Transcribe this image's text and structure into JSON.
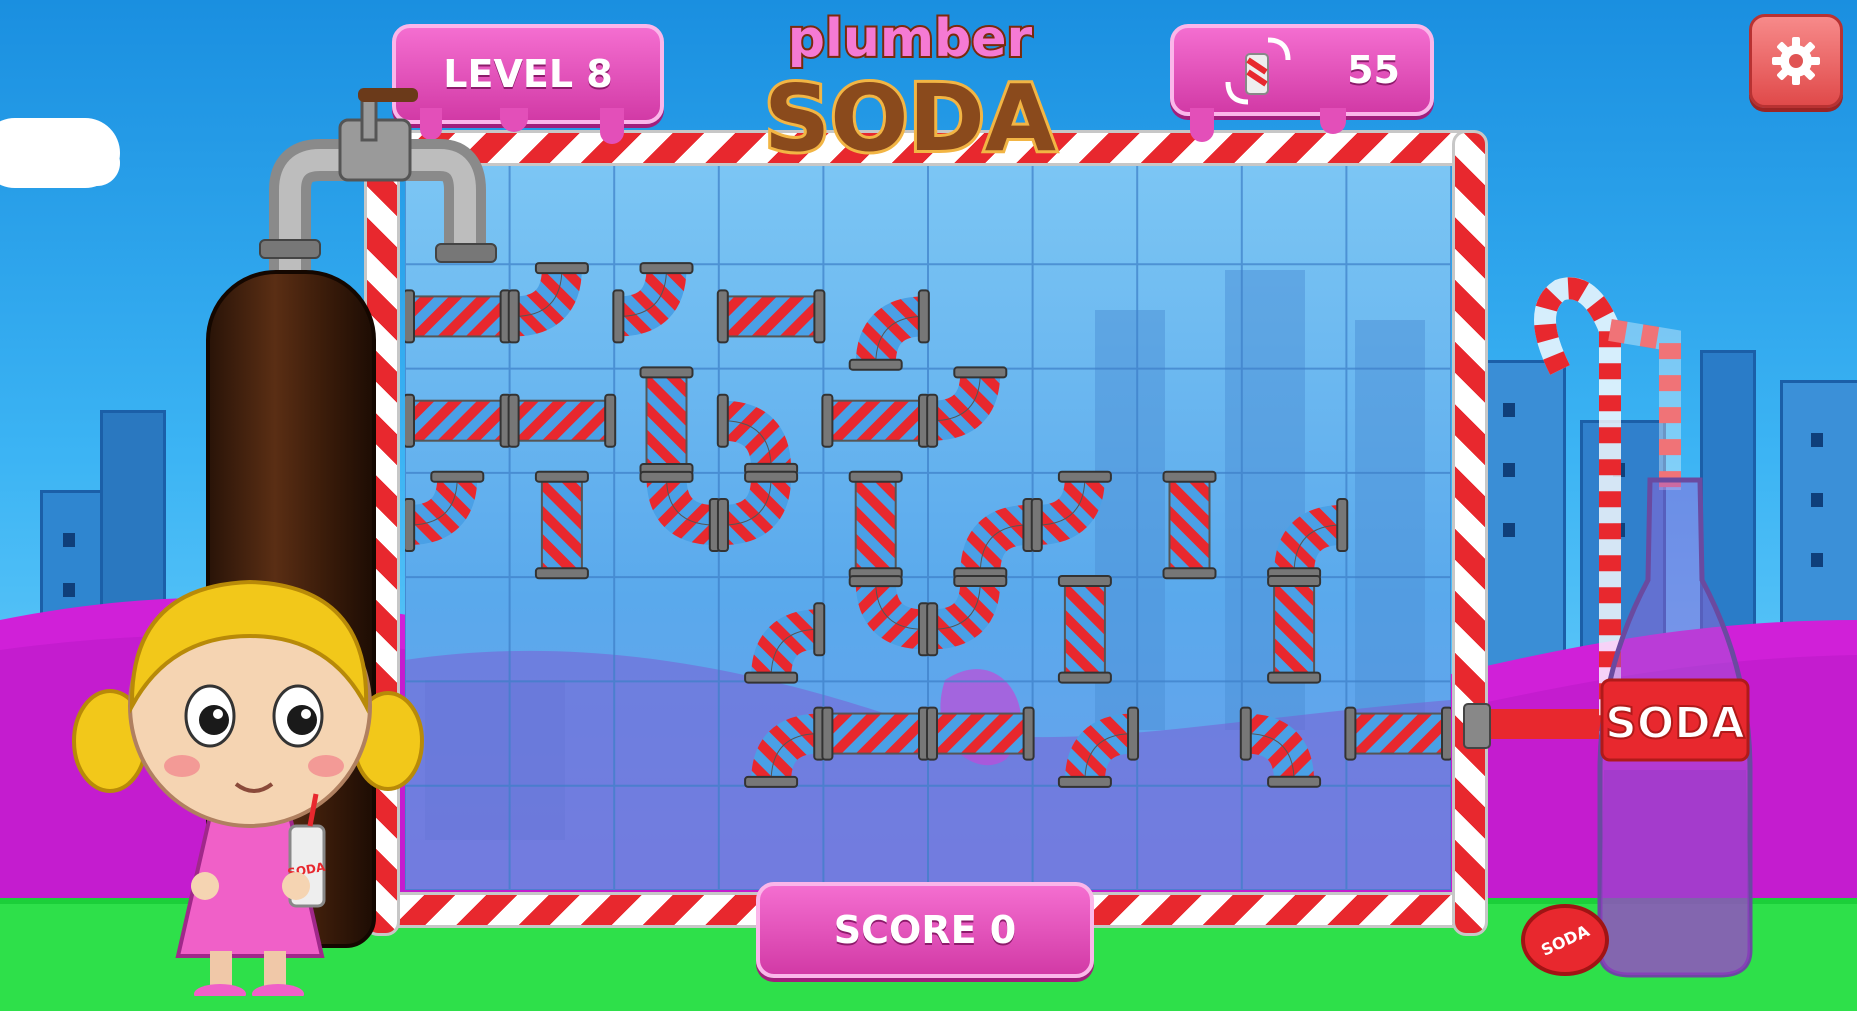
{
  "game": {
    "title_top": "plumber",
    "title_bottom": "SODA",
    "level_label": "LEVEL 8",
    "moves_count": "55",
    "score_label": "SCORE 0",
    "bottle_label": "SODA",
    "cup_label": "SODA",
    "cap_label": "SODA"
  },
  "icons": {
    "settings": "gear-icon",
    "moves": "rotate-pipe-icon"
  },
  "colors": {
    "pipe_red": "#e8282e",
    "pipe_blue": "#4aa0e6",
    "hud_pink": "#e34fb9",
    "settings_red": "#e05454",
    "grass": "#2ee04a",
    "hill_purple": "#d020d8"
  },
  "board": {
    "cols": 10,
    "rows": 7,
    "pieces": [
      {
        "c": 0,
        "r": 1,
        "type": "straight",
        "rot": 0
      },
      {
        "c": 1,
        "r": 1,
        "type": "elbow",
        "rot": 90
      },
      {
        "c": 2,
        "r": 1,
        "type": "elbow",
        "rot": 90
      },
      {
        "c": 3,
        "r": 1,
        "type": "straight",
        "rot": 0
      },
      {
        "c": 4,
        "r": 1,
        "type": "elbow",
        "rot": 270
      },
      {
        "c": 0,
        "r": 2,
        "type": "straight",
        "rot": 0
      },
      {
        "c": 1,
        "r": 2,
        "type": "straight",
        "rot": 0
      },
      {
        "c": 2,
        "r": 2,
        "type": "straight",
        "rot": 90
      },
      {
        "c": 3,
        "r": 2,
        "type": "elbow",
        "rot": 0
      },
      {
        "c": 4,
        "r": 2,
        "type": "straight",
        "rot": 0
      },
      {
        "c": 5,
        "r": 2,
        "type": "elbow",
        "rot": 90
      },
      {
        "c": 0,
        "r": 3,
        "type": "elbow",
        "rot": 90
      },
      {
        "c": 1,
        "r": 3,
        "type": "straight",
        "rot": 90
      },
      {
        "c": 2,
        "r": 3,
        "type": "elbow",
        "rot": 180
      },
      {
        "c": 3,
        "r": 3,
        "type": "elbow",
        "rot": 90
      },
      {
        "c": 4,
        "r": 3,
        "type": "straight",
        "rot": 90
      },
      {
        "c": 5,
        "r": 3,
        "type": "elbow",
        "rot": 270
      },
      {
        "c": 6,
        "r": 3,
        "type": "elbow",
        "rot": 90
      },
      {
        "c": 7,
        "r": 3,
        "type": "straight",
        "rot": 90
      },
      {
        "c": 8,
        "r": 3,
        "type": "elbow",
        "rot": 270
      },
      {
        "c": 3,
        "r": 4,
        "type": "elbow",
        "rot": 270
      },
      {
        "c": 4,
        "r": 4,
        "type": "elbow",
        "rot": 180
      },
      {
        "c": 5,
        "r": 4,
        "type": "elbow",
        "rot": 90
      },
      {
        "c": 6,
        "r": 4,
        "type": "straight",
        "rot": 90
      },
      {
        "c": 8,
        "r": 4,
        "type": "straight",
        "rot": 90
      },
      {
        "c": 3,
        "r": 5,
        "type": "elbow",
        "rot": 270
      },
      {
        "c": 4,
        "r": 5,
        "type": "straight",
        "rot": 0
      },
      {
        "c": 5,
        "r": 5,
        "type": "straight",
        "rot": 0
      },
      {
        "c": 6,
        "r": 5,
        "type": "elbow",
        "rot": 270
      },
      {
        "c": 8,
        "r": 5,
        "type": "elbow",
        "rot": 0
      },
      {
        "c": 9,
        "r": 5,
        "type": "straight",
        "rot": 0
      }
    ]
  }
}
